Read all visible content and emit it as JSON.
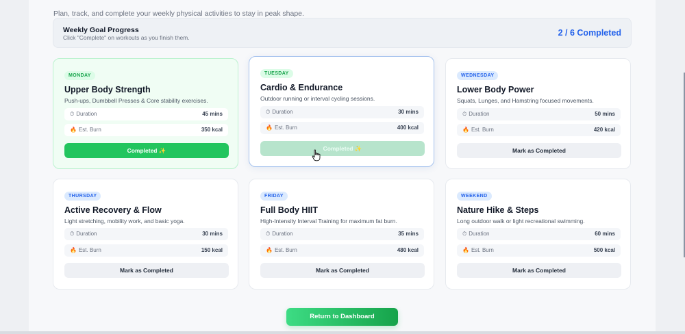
{
  "header": {
    "subtitle": "Plan, track, and complete your weekly physical activities to stay in peak shape."
  },
  "goal": {
    "title": "Weekly Goal Progress",
    "hint": "Click \"Complete\" on workouts as you finish them.",
    "count": "2 / 6 Completed"
  },
  "stat_labels": {
    "duration": "Duration",
    "burn": "Est. Burn"
  },
  "icons": {
    "duration": "stopwatch-icon",
    "burn": "fire-icon"
  },
  "cards": [
    {
      "day": "MONDAY",
      "title": "Upper Body Strength",
      "desc": "Push-ups, Dumbbell Presses & Core stability exercises.",
      "duration": "45 mins",
      "burn": "350 kcal",
      "button": "Completed ✨",
      "status": "completed"
    },
    {
      "day": "TUESDAY",
      "title": "Cardio & Endurance",
      "desc": "Outdoor running or interval cycling sessions.",
      "duration": "30 mins",
      "burn": "400 kcal",
      "button": "Completed ✨",
      "status": "completed"
    },
    {
      "day": "WEDNESDAY",
      "title": "Lower Body Power",
      "desc": "Squats, Lunges, and Hamstring focused movements.",
      "duration": "50 mins",
      "burn": "420 kcal",
      "button": "Mark as Completed",
      "status": "pending"
    },
    {
      "day": "THURSDAY",
      "title": "Active Recovery & Flow",
      "desc": "Light stretching, mobility work, and basic yoga.",
      "duration": "30 mins",
      "burn": "150 kcal",
      "button": "Mark as Completed",
      "status": "pending"
    },
    {
      "day": "FRIDAY",
      "title": "Full Body HIIT",
      "desc": "High-Intensity Interval Training for maximum fat burn.",
      "duration": "35 mins",
      "burn": "480 kcal",
      "button": "Mark as Completed",
      "status": "pending"
    },
    {
      "day": "WEEKEND",
      "title": "Nature Hike & Steps",
      "desc": "Long outdoor walk or light recreational swimming.",
      "duration": "60 mins",
      "burn": "500 kcal",
      "button": "Mark as Completed",
      "status": "pending"
    }
  ],
  "footer": {
    "return_label": "Return to Dashboard"
  },
  "colors": {
    "accent_blue": "#2563eb",
    "success_green": "#22c55e",
    "page_bg": "#f7f8fa"
  }
}
